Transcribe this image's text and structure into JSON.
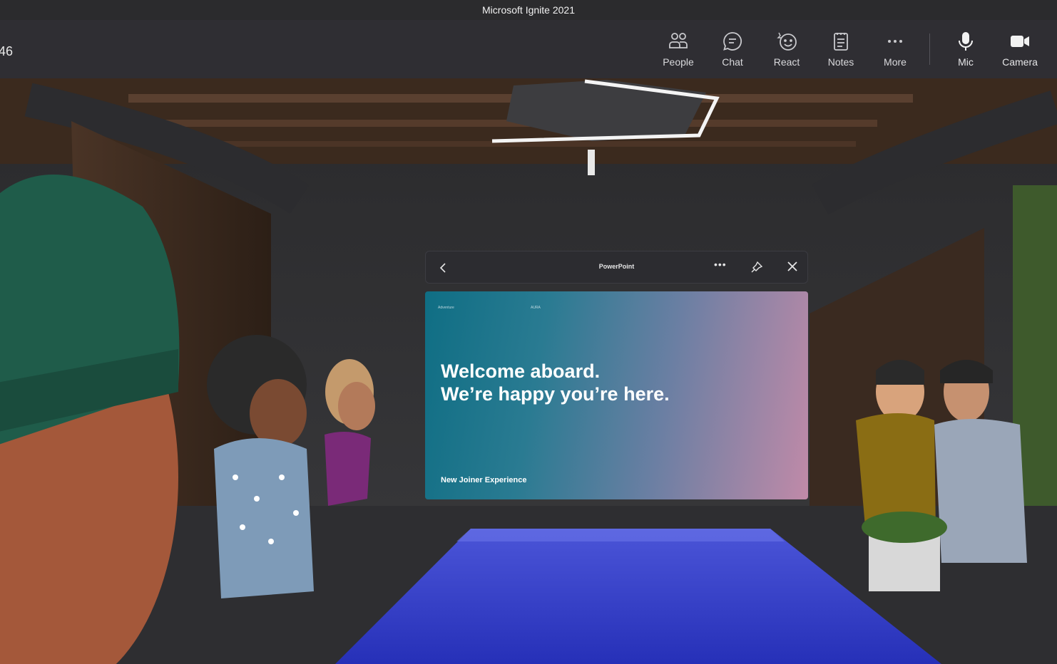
{
  "window": {
    "title": "Microsoft Ignite 2021"
  },
  "meeting": {
    "timer_fragment": "46"
  },
  "toolbar": {
    "items": [
      {
        "label": "People",
        "icon": "people-icon"
      },
      {
        "label": "Chat",
        "icon": "chat-icon"
      },
      {
        "label": "React",
        "icon": "react-icon"
      },
      {
        "label": "Notes",
        "icon": "notes-icon"
      },
      {
        "label": "More",
        "icon": "more-icon"
      },
      {
        "label": "Mic",
        "icon": "mic-icon"
      },
      {
        "label": "Camera",
        "icon": "camera-icon"
      }
    ]
  },
  "ppt_window": {
    "title": "PowerPoint",
    "controls": [
      "back-icon",
      "more-options-icon",
      "pin-icon",
      "close-icon"
    ]
  },
  "slide": {
    "tiny_left": "Adventure",
    "tiny_center": "AURA",
    "headline_line1": "Welcome aboard.",
    "headline_line2": "We’re happy you’re here.",
    "footer": "New Joiner Experience"
  },
  "colors": {
    "title_bar": "#2b2b2d",
    "toolbar": "#2f2e33",
    "slide_gradient_start": "#0f6e84",
    "slide_gradient_end": "#c08aa8",
    "table_blue": "#3340c8"
  }
}
